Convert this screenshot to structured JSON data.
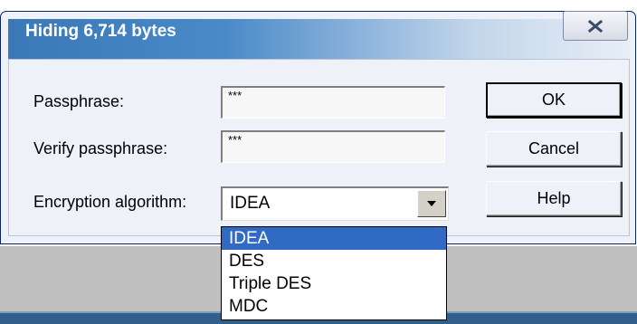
{
  "dialog": {
    "title": "Hiding 6,714 bytes",
    "close_label": "X"
  },
  "form": {
    "passphrase_label": "Passphrase:",
    "passphrase_value": "***",
    "verify_label": "Verify passphrase:",
    "verify_value": "***",
    "algorithm_label": "Encryption algorithm:",
    "algorithm_value": "IDEA"
  },
  "buttons": {
    "ok": "OK",
    "cancel": "Cancel",
    "help": "Help"
  },
  "dropdown": {
    "options": [
      "IDEA",
      "DES",
      "Triple DES",
      "MDC"
    ],
    "selected": "IDEA"
  },
  "icons": {
    "close": "close-icon",
    "combo_arrow": "chevron-down-icon"
  }
}
